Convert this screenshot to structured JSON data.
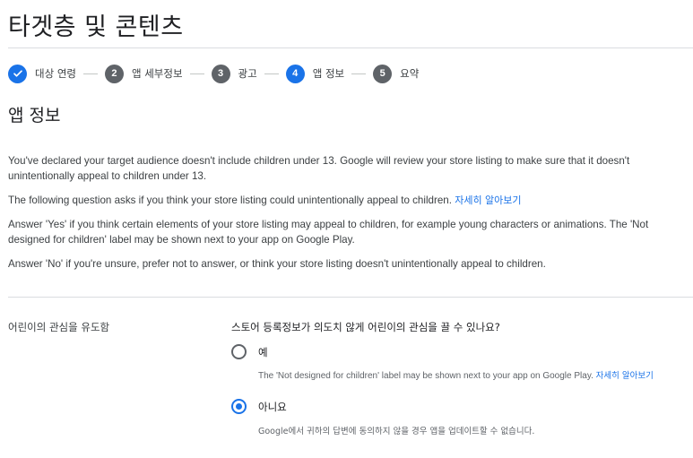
{
  "page": {
    "title": "타겟층 및 콘텐츠"
  },
  "stepper": {
    "steps": [
      {
        "number": "",
        "label": "대상 연령",
        "state": "done"
      },
      {
        "number": "2",
        "label": "앱 세부정보",
        "state": "todo"
      },
      {
        "number": "3",
        "label": "광고",
        "state": "todo"
      },
      {
        "number": "4",
        "label": "앱 정보",
        "state": "active"
      },
      {
        "number": "5",
        "label": "요약",
        "state": "todo"
      }
    ]
  },
  "section": {
    "title": "앱 정보",
    "para1": "You've declared your target audience doesn't include children under 13. Google will review your store listing to make sure that it doesn't unintentionally appeal to children under 13.",
    "para2": "The following question asks if you think your store listing could unintentionally appeal to children.",
    "para2_link": "자세히 알아보기",
    "para3": "Answer 'Yes' if you think certain elements of your store listing may appeal to children, for example young characters or animations. The 'Not designed for children' label may be shown next to your app on Google Play.",
    "para4": "Answer 'No' if you're unsure, prefer not to answer, or think your store listing doesn't unintentionally appeal to children."
  },
  "appeal": {
    "label": "어린이의 관심을 유도함",
    "question": "스토어 등록정보가 의도치 않게 어린이의 관심을 끌 수 있나요?",
    "options": [
      {
        "label": "예",
        "checked": false,
        "desc": "The 'Not designed for children' label may be shown next to your app on Google Play.",
        "desc_link": "자세히 알아보기"
      },
      {
        "label": "아니요",
        "checked": true,
        "desc": "Google에서 귀하의 답변에 동의하지 않을 경우 앱을 업데이트할 수 없습니다."
      }
    ]
  },
  "colors": {
    "accent": "#1a73e8",
    "step_inactive": "#5f6368",
    "divider": "#dadce0"
  }
}
